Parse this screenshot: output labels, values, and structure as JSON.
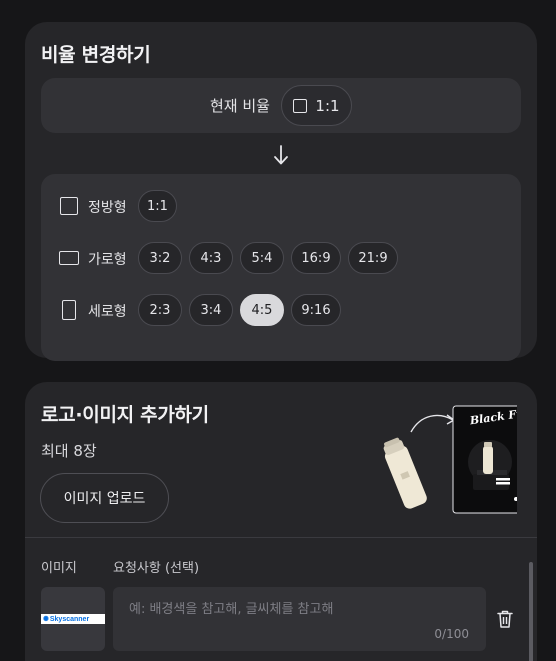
{
  "ratio_card": {
    "title": "비율 변경하기",
    "current_label": "현재 비율",
    "current_value": "1:1",
    "rows": [
      {
        "label": "정방형",
        "options": [
          "1:1"
        ]
      },
      {
        "label": "가로형",
        "options": [
          "3:2",
          "4:3",
          "5:4",
          "16:9",
          "21:9"
        ]
      },
      {
        "label": "세로형",
        "options": [
          "2:3",
          "3:4",
          "4:5",
          "9:16"
        ]
      }
    ],
    "selected": "4:5"
  },
  "logo_card": {
    "title": "로고·이미지 추가하기",
    "subtitle": "최대 8장",
    "upload_label": "이미지 업로드",
    "illustration_text": "Black Friday",
    "col_image": "이미지",
    "col_request": "요청사항 (선택)",
    "thumb_logo_text": "Skyscanner",
    "request_placeholder": "예: 배경색을 참고해, 글씨체를 참고해",
    "request_counter": "0/100"
  },
  "icons": {
    "arrow": "arrow-down-icon",
    "square": "square-ratio-icon",
    "landscape": "landscape-ratio-icon",
    "portrait": "portrait-ratio-icon",
    "trash": "trash-icon"
  }
}
